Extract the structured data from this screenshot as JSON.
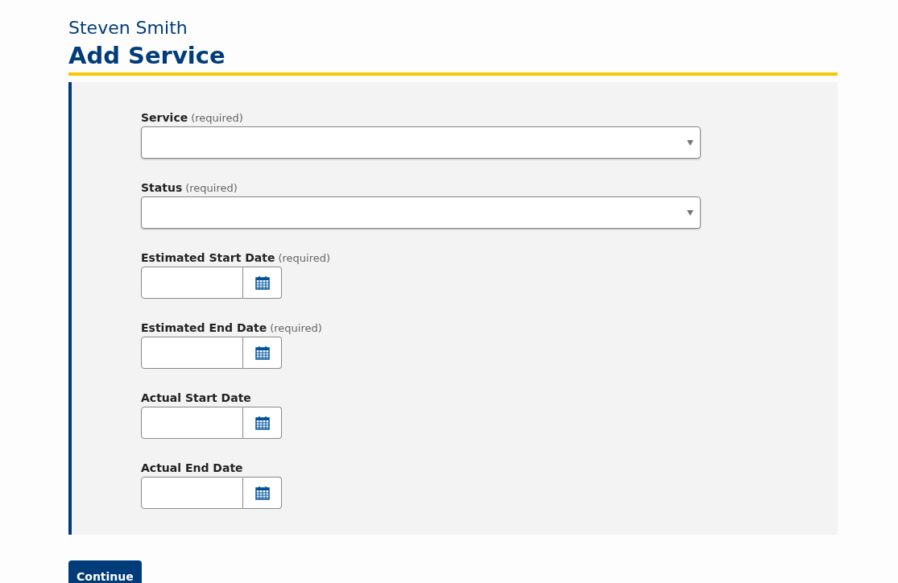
{
  "header": {
    "name": "Steven Smith",
    "title": "Add Service"
  },
  "fields": [
    {
      "kind": "select",
      "label": "Service",
      "note": "(required)"
    },
    {
      "kind": "select",
      "label": "Status",
      "note": "(required)"
    },
    {
      "kind": "date",
      "label": "Estimated Start Date",
      "note": "(required)"
    },
    {
      "kind": "date",
      "label": "Estimated End Date",
      "note": "(required)"
    },
    {
      "kind": "date",
      "label": "Actual Start Date"
    },
    {
      "kind": "date",
      "label": "Actual End Date"
    }
  ],
  "buttons": [
    {
      "label": "Continue"
    }
  ]
}
